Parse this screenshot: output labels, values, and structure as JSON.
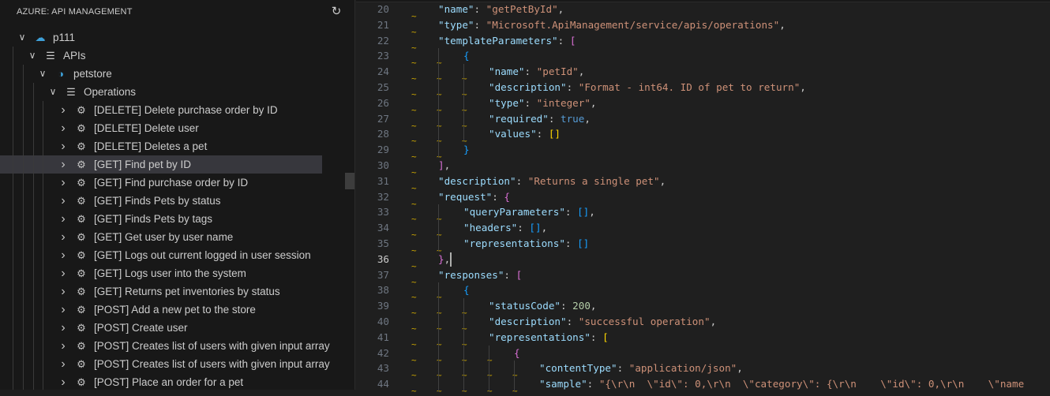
{
  "sidebar": {
    "title": "AZURE: API MANAGEMENT",
    "refresh_icon": "refresh-icon",
    "tree": [
      {
        "label": "p111",
        "level": 0,
        "icon": "cloud-service-icon"
      },
      {
        "label": "APIs",
        "level": 1,
        "icon": "list-icon"
      },
      {
        "label": "petstore",
        "level": 2,
        "icon": "api-icon"
      },
      {
        "label": "Operations",
        "level": 3,
        "icon": "list-icon"
      },
      {
        "label": "[DELETE] Delete purchase order by ID",
        "level": 4,
        "icon": "gears-icon"
      },
      {
        "label": "[DELETE] Delete user",
        "level": 4,
        "icon": "gears-icon"
      },
      {
        "label": "[DELETE] Deletes a pet",
        "level": 4,
        "icon": "gears-icon"
      },
      {
        "label": "[GET] Find pet by ID",
        "level": 4,
        "icon": "gears-icon",
        "selected": true
      },
      {
        "label": "[GET] Find purchase order by ID",
        "level": 4,
        "icon": "gears-icon"
      },
      {
        "label": "[GET] Finds Pets by status",
        "level": 4,
        "icon": "gears-icon"
      },
      {
        "label": "[GET] Finds Pets by tags",
        "level": 4,
        "icon": "gears-icon"
      },
      {
        "label": "[GET] Get user by user name",
        "level": 4,
        "icon": "gears-icon"
      },
      {
        "label": "[GET] Logs out current logged in user session",
        "level": 4,
        "icon": "gears-icon"
      },
      {
        "label": "[GET] Logs user into the system",
        "level": 4,
        "icon": "gears-icon"
      },
      {
        "label": "[GET] Returns pet inventories by status",
        "level": 4,
        "icon": "gears-icon"
      },
      {
        "label": "[POST] Add a new pet to the store",
        "level": 4,
        "icon": "gears-icon"
      },
      {
        "label": "[POST] Create user",
        "level": 4,
        "icon": "gears-icon"
      },
      {
        "label": "[POST] Creates list of users with given input array",
        "level": 4,
        "icon": "gears-icon"
      },
      {
        "label": "[POST] Creates list of users with given input array",
        "level": 4,
        "icon": "gears-icon"
      },
      {
        "label": "[POST] Place an order for a pet",
        "level": 4,
        "icon": "gears-icon"
      }
    ]
  },
  "editor": {
    "current_line": 36,
    "lines": [
      {
        "n": "20",
        "indent": 1,
        "t": [
          [
            "k",
            "\"name\""
          ],
          [
            "p",
            ": "
          ],
          [
            "s",
            "\"getPetById\""
          ],
          [
            "p",
            ","
          ]
        ]
      },
      {
        "n": "21",
        "indent": 1,
        "t": [
          [
            "k",
            "\"type\""
          ],
          [
            "p",
            ": "
          ],
          [
            "s",
            "\"Microsoft.ApiManagement/service/apis/operations\""
          ],
          [
            "p",
            ","
          ]
        ]
      },
      {
        "n": "22",
        "indent": 1,
        "t": [
          [
            "k",
            "\"templateParameters\""
          ],
          [
            "p",
            ": "
          ],
          [
            "m",
            "["
          ]
        ]
      },
      {
        "n": "23",
        "indent": 2,
        "t": [
          [
            "c",
            "{"
          ]
        ]
      },
      {
        "n": "24",
        "indent": 3,
        "t": [
          [
            "k",
            "\"name\""
          ],
          [
            "p",
            ": "
          ],
          [
            "s",
            "\"petId\""
          ],
          [
            "p",
            ","
          ]
        ]
      },
      {
        "n": "25",
        "indent": 3,
        "t": [
          [
            "k",
            "\"description\""
          ],
          [
            "p",
            ": "
          ],
          [
            "s",
            "\"Format - int64. ID of pet to return\""
          ],
          [
            "p",
            ","
          ]
        ]
      },
      {
        "n": "26",
        "indent": 3,
        "t": [
          [
            "k",
            "\"type\""
          ],
          [
            "p",
            ": "
          ],
          [
            "s",
            "\"integer\""
          ],
          [
            "p",
            ","
          ]
        ]
      },
      {
        "n": "27",
        "indent": 3,
        "t": [
          [
            "k",
            "\"required\""
          ],
          [
            "p",
            ": "
          ],
          [
            "b",
            "true"
          ],
          [
            "p",
            ","
          ]
        ]
      },
      {
        "n": "28",
        "indent": 3,
        "t": [
          [
            "k",
            "\"values\""
          ],
          [
            "p",
            ": "
          ],
          [
            "g",
            "[]"
          ]
        ]
      },
      {
        "n": "29",
        "indent": 2,
        "t": [
          [
            "c",
            "}"
          ]
        ]
      },
      {
        "n": "30",
        "indent": 1,
        "t": [
          [
            "m",
            "]"
          ],
          [
            "p",
            ","
          ]
        ]
      },
      {
        "n": "31",
        "indent": 1,
        "t": [
          [
            "k",
            "\"description\""
          ],
          [
            "p",
            ": "
          ],
          [
            "s",
            "\"Returns a single pet\""
          ],
          [
            "p",
            ","
          ]
        ]
      },
      {
        "n": "32",
        "indent": 1,
        "t": [
          [
            "k",
            "\"request\""
          ],
          [
            "p",
            ": "
          ],
          [
            "m",
            "{"
          ]
        ]
      },
      {
        "n": "33",
        "indent": 2,
        "t": [
          [
            "k",
            "\"queryParameters\""
          ],
          [
            "p",
            ": "
          ],
          [
            "c",
            "[]"
          ],
          [
            "p",
            ","
          ]
        ]
      },
      {
        "n": "34",
        "indent": 2,
        "t": [
          [
            "k",
            "\"headers\""
          ],
          [
            "p",
            ": "
          ],
          [
            "c",
            "[]"
          ],
          [
            "p",
            ","
          ]
        ]
      },
      {
        "n": "35",
        "indent": 2,
        "t": [
          [
            "k",
            "\"representations\""
          ],
          [
            "p",
            ": "
          ],
          [
            "c",
            "[]"
          ]
        ]
      },
      {
        "n": "36",
        "indent": 1,
        "t": [
          [
            "m",
            "}"
          ],
          [
            "p",
            ","
          ]
        ]
      },
      {
        "n": "37",
        "indent": 1,
        "t": [
          [
            "k",
            "\"responses\""
          ],
          [
            "p",
            ": "
          ],
          [
            "m",
            "["
          ]
        ]
      },
      {
        "n": "38",
        "indent": 2,
        "t": [
          [
            "c",
            "{"
          ]
        ]
      },
      {
        "n": "39",
        "indent": 3,
        "t": [
          [
            "k",
            "\"statusCode\""
          ],
          [
            "p",
            ": "
          ],
          [
            "n",
            "200"
          ],
          [
            "p",
            ","
          ]
        ]
      },
      {
        "n": "40",
        "indent": 3,
        "t": [
          [
            "k",
            "\"description\""
          ],
          [
            "p",
            ": "
          ],
          [
            "s",
            "\"successful operation\""
          ],
          [
            "p",
            ","
          ]
        ]
      },
      {
        "n": "41",
        "indent": 3,
        "t": [
          [
            "k",
            "\"representations\""
          ],
          [
            "p",
            ": "
          ],
          [
            "g",
            "["
          ]
        ]
      },
      {
        "n": "42",
        "indent": 4,
        "t": [
          [
            "m",
            "{"
          ]
        ]
      },
      {
        "n": "43",
        "indent": 5,
        "t": [
          [
            "k",
            "\"contentType\""
          ],
          [
            "p",
            ": "
          ],
          [
            "s",
            "\"application/json\""
          ],
          [
            "p",
            ","
          ]
        ]
      },
      {
        "n": "44",
        "indent": 5,
        "t": [
          [
            "k",
            "\"sample\""
          ],
          [
            "p",
            ": "
          ],
          [
            "s",
            "\"{\\r\\n  \\\"id\\\": 0,\\r\\n  \\\"category\\\": {\\r\\n    \\\"id\\\": 0,\\r\\n    \\\"name"
          ]
        ]
      }
    ]
  }
}
